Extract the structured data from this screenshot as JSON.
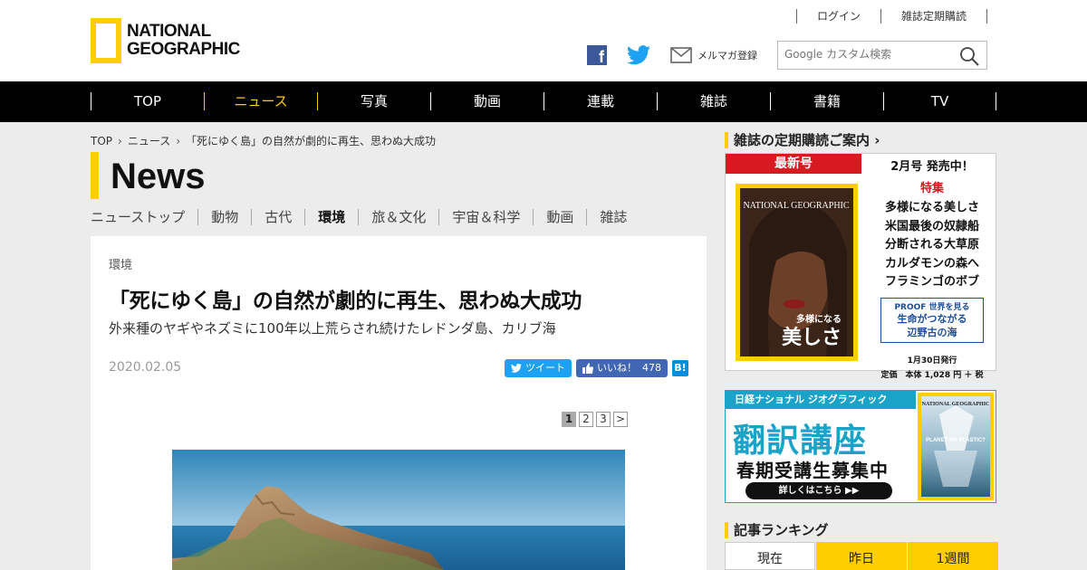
{
  "header": {
    "logo_text_line1": "NATIONAL",
    "logo_text_line2": "GEOGRAPHIC",
    "toplinks": [
      "ログイン",
      "雑誌定期購読"
    ],
    "mail_label": "メルマガ登録",
    "search_placeholder": "Google カスタム検索"
  },
  "nav": {
    "items": [
      "TOP",
      "ニュース",
      "写真",
      "動画",
      "連載",
      "雑誌",
      "書籍",
      "TV"
    ],
    "active": "ニュース",
    "accent": "#ffce00"
  },
  "breadcrumb": [
    "TOP",
    "ニュース",
    "「死にゆく島」の自然が劇的に再生、思わぬ大成功"
  ],
  "section_title": "News",
  "subnav": [
    "ニューストップ",
    "動物",
    "古代",
    "環境",
    "旅＆文化",
    "宇宙＆科学",
    "動画",
    "雑誌"
  ],
  "subnav_active": "環境",
  "article": {
    "category": "環境",
    "headline": "「死にゆく島」の自然が劇的に再生、思わぬ大成功",
    "deck": "外来種のヤギやネズミに100年以上荒らされ続けたレドンダ島、カリブ海",
    "date": "2020.02.05",
    "tweet_label": "ツイート",
    "like_label": "いいね！",
    "like_count": "478",
    "hatena_label": "B!",
    "pages": [
      "1",
      "2",
      "3",
      ">"
    ],
    "current_page": "1"
  },
  "sidebar": {
    "subscription_heading": "雑誌の定期購読ご案内",
    "magazine": {
      "tag": "最新号",
      "issue": "2月号 発売中！",
      "feature_label": "特集",
      "stories": [
        "多様になる美しさ",
        "米国最後の奴隷船",
        "分断される大草原",
        "カルダモンの森へ",
        "フラミンゴのボブ"
      ],
      "proof_line1": "PROOF 世界を見る",
      "proof_line2": "生命がつながる",
      "proof_line3": "辺野古の海",
      "release": "1月30日発行",
      "price": "定価　本体 1,028 円 ＋ 税",
      "cover_title": "美しさ",
      "cover_title_small": "多様になる",
      "cover_brand": "NATIONAL GEOGRAPHIC"
    },
    "ad": {
      "bar": "日経ナショナル ジオグラフィック",
      "title": "翻訳講座",
      "sub": "春期受講生募集中",
      "button": "詳しくはこちら ▶▶",
      "cover_brand": "NATIONAL GEOGRAPHIC",
      "cover_text": "PLANET OR PLASTIC?"
    },
    "ranking_heading": "記事ランキング",
    "ranking_tabs": [
      "現在",
      "昨日",
      "1週間"
    ],
    "ranking_active": "現在"
  }
}
